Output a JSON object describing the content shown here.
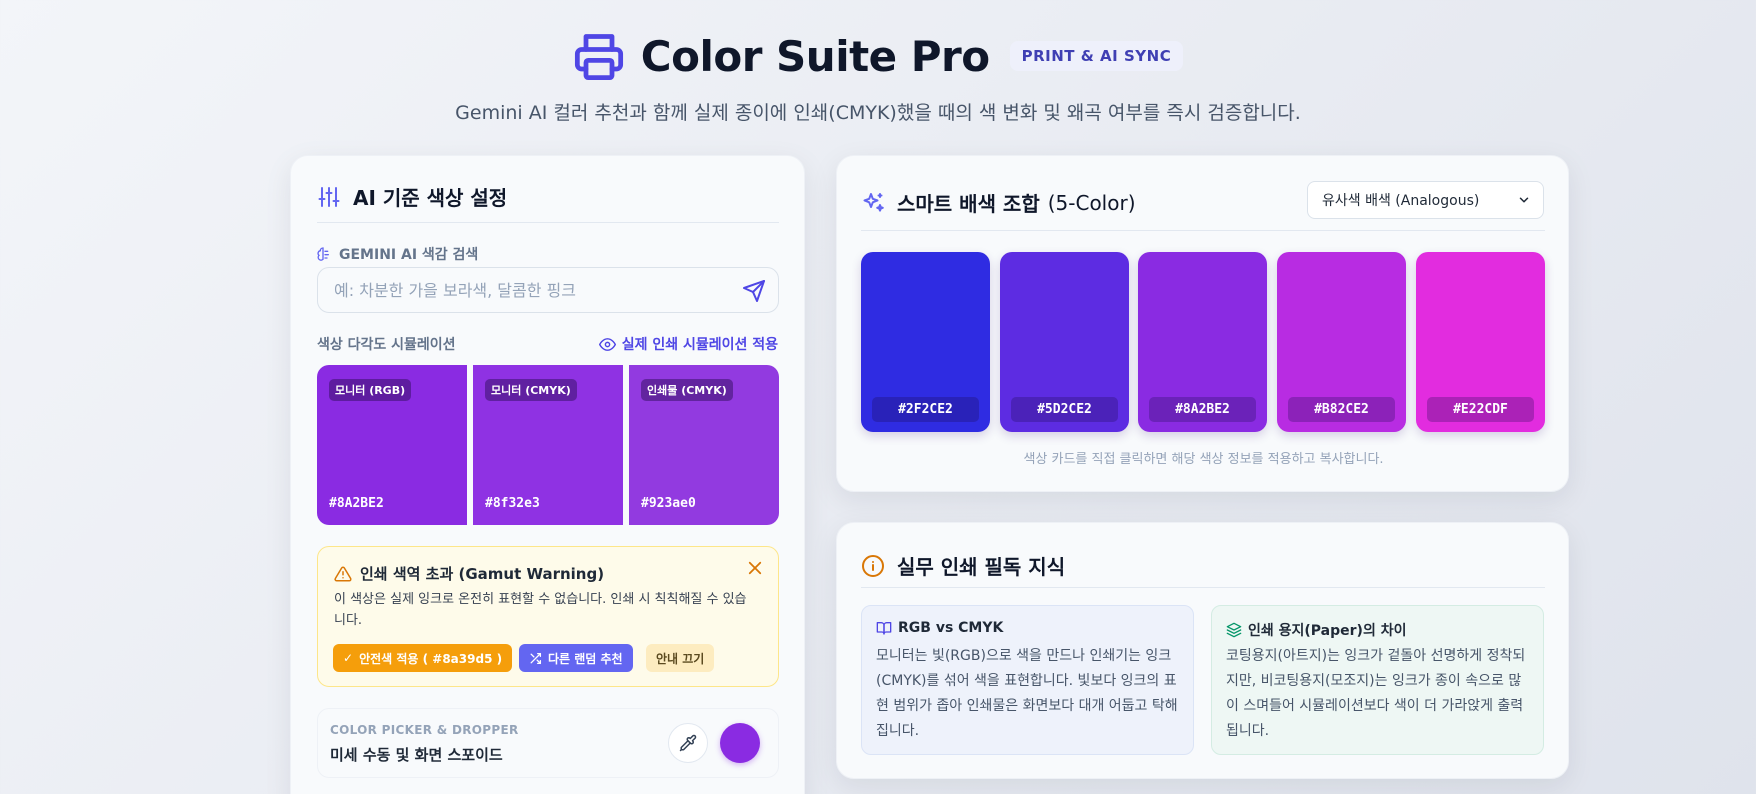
{
  "header": {
    "title": "Color Suite Pro",
    "badge": "PRINT & AI SYNC",
    "subtitle": "Gemini AI 컬러 추천과 함께 실제 종이에 인쇄(CMYK)했을 때의 색 변화 및 왜곡 여부를 즉시 검증합니다."
  },
  "left": {
    "title": "AI 기준 색상 설정",
    "ai_label": "GEMINI AI 색감 검색",
    "search_placeholder": "예: 차분한 가을 보라색, 달콤한 핑크",
    "sim_label": "색상 다각도 시뮬레이션",
    "sim_link": "실제 인쇄 시뮬레이션 적용",
    "panels": [
      {
        "tag": "모니터 (RGB)",
        "hex": "#8A2BE2",
        "color": "#8A2BE2"
      },
      {
        "tag": "모니터 (CMYK)",
        "hex": "#8f32e3",
        "color": "#8f32e3"
      },
      {
        "tag": "인쇄물 (CMYK)",
        "hex": "#923ae0",
        "color": "#923ae0"
      }
    ],
    "warning": {
      "title": "인쇄 색역 초과 (Gamut Warning)",
      "text": "이 색상은 실제 잉크로 온전히 표현할 수 없습니다. 인쇄 시 칙칙해질 수 있습니다.",
      "btn_safe": "안전색 적용 ( #8a39d5 )",
      "btn_random": "다른 랜덤 추천",
      "btn_off": "안내 끄기"
    },
    "picker": {
      "caption": "COLOR PICKER & DROPPER",
      "title": "미세 수동 및 화면 스포이드",
      "current_color": "#8A2BE2"
    }
  },
  "palette": {
    "title": "스마트 배색 조합",
    "title_suffix": "(5-Color)",
    "scheme": "유사색 배색 (Analogous)",
    "colors": [
      "#2F2CE2",
      "#5D2CE2",
      "#8A2BE2",
      "#B82CE2",
      "#E22CDF"
    ],
    "hint": "색상 카드를 직접 클릭하면 해당 색상 정보를 적용하고 복사합니다."
  },
  "tips": {
    "title": "실무 인쇄 필독 지식",
    "items": [
      {
        "title": "RGB vs CMYK",
        "text": "모니터는 빛(RGB)으로 색을 만드나 인쇄기는 잉크(CMYK)를 섞어 색을 표현합니다. 빛보다 잉크의 표현 범위가 좁아 인쇄물은 화면보다 대개 어둡고 탁해집니다."
      },
      {
        "title": "인쇄 용지(Paper)의 차이",
        "text": "코팅용지(아트지)는 잉크가 겉돌아 선명하게 정착되지만, 비코팅용지(모조지)는 잉크가 종이 속으로 많이 스며들어 시뮬레이션보다 색이 더 가라앉게 출력됩니다."
      }
    ]
  },
  "colors": {
    "accent": "#4f46e5",
    "warning": "#f59e0b"
  }
}
